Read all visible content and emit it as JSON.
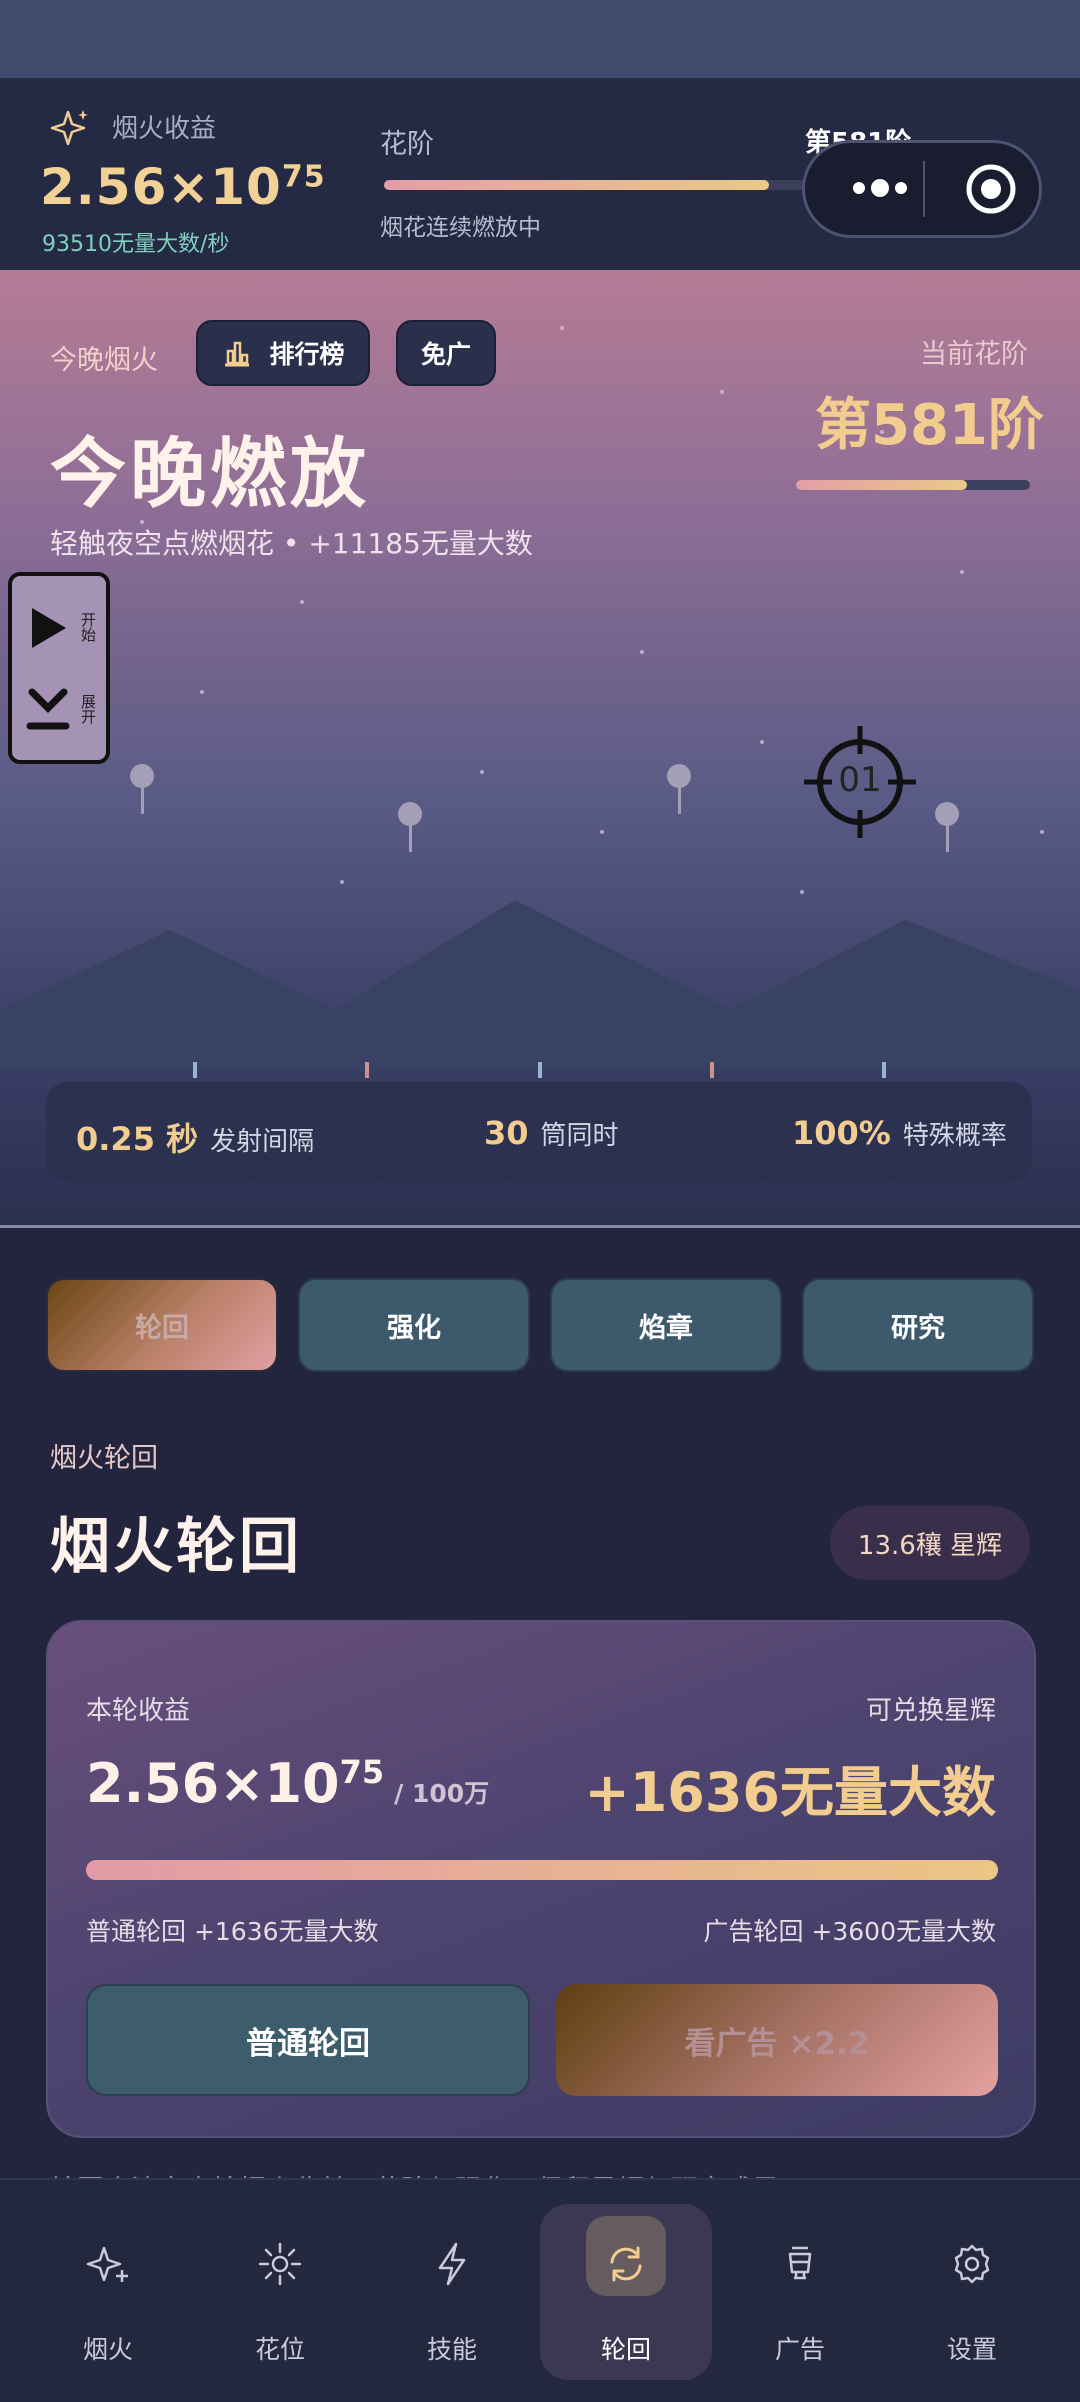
{
  "header": {
    "income_label": "烟火收益",
    "income_value_base": "2.56×10",
    "income_value_exp": "75",
    "income_rate": "93510无量大数/秒",
    "tier_label": "花阶",
    "tier_number": "第581阶",
    "tier_status": "烟花连续燃放中",
    "tier_progress": 0.74
  },
  "hero": {
    "kicker": "今晚烟火",
    "leaderboard_label": "排行榜",
    "no_ads_label": "免广",
    "title": "今晚燃放",
    "subtitle": "轻触夜空点燃烟花 • +11185无量大数",
    "current_tier_label": "当前花阶",
    "current_tier_value": "第581阶",
    "current_tier_progress": 0.73,
    "side_start_label": "开始",
    "side_expand_label": "展开",
    "crosshair_text": "01",
    "stats": [
      {
        "value": "0.25 秒",
        "label": "发射间隔"
      },
      {
        "value": "30",
        "label": "筒同时"
      },
      {
        "value": "100%",
        "label": "特殊概率"
      }
    ]
  },
  "tabs": [
    {
      "label": "轮回",
      "active": true
    },
    {
      "label": "强化",
      "active": false
    },
    {
      "label": "焰章",
      "active": false
    },
    {
      "label": "研究",
      "active": false
    }
  ],
  "section": {
    "kicker": "烟火轮回",
    "title": "烟火轮回",
    "badge": "13.6穰 星辉"
  },
  "card": {
    "income_label": "本轮收益",
    "exchange_label": "可兑换星辉",
    "income_base": "2.56×10",
    "income_exp": "75",
    "income_unit": "/ 100万",
    "reward": "+1636无量大数",
    "progress": 1.0,
    "normal_note": "普通轮回 +1636无量大数",
    "ad_note": "广告轮回 +3600无量大数",
    "normal_button": "普通轮回",
    "ad_button": "看广告 ×2.2"
  },
  "peek_text": "轮回会清空本轮烟火收益、花阶与强化，保留星辉与研究成果",
  "nav": [
    {
      "label": "烟火",
      "icon": "sparkle-icon",
      "active": false
    },
    {
      "label": "花位",
      "icon": "sun-icon",
      "active": false
    },
    {
      "label": "技能",
      "icon": "lightning-icon",
      "active": false
    },
    {
      "label": "轮回",
      "icon": "refresh-icon",
      "active": true
    },
    {
      "label": "广告",
      "icon": "lantern-icon",
      "active": false
    },
    {
      "label": "设置",
      "icon": "gear-icon",
      "active": false
    }
  ],
  "colors": {
    "accent_gold": "#f2cd8f",
    "teal": "#7fd0bd",
    "tab_inactive": "#3d5a6c",
    "background": "#23253f"
  }
}
